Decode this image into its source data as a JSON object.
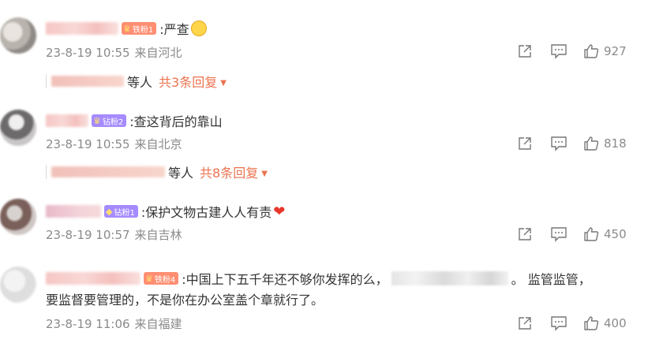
{
  "comments": [
    {
      "badge": "铁粉1",
      "text": ":严查",
      "time": "23-8-19 10:55",
      "source": "来自河北",
      "likes": "927",
      "sub": {
        "deng": "等人",
        "more": "共3条回复"
      }
    },
    {
      "badge": "钻粉2",
      "text": ":查这背后的靠山",
      "time": "23-8-19 10:55",
      "source": "来自北京",
      "likes": "818",
      "sub": {
        "deng": "等人",
        "more": "共8条回复"
      }
    },
    {
      "badge": "钻粉1",
      "text": ":保护文物古建人人有责",
      "time": "23-8-19 10:57",
      "source": "来自吉林",
      "likes": "450"
    },
    {
      "badge": "铁粉4",
      "text_part1": ":中国上下五千年还不够你发挥的么，",
      "text_part2": "。 监管监管，",
      "text_line2": "要监督要管理的，不是你在办公室盖个章就行了。",
      "time": "23-8-19 11:06",
      "source": "来自福建",
      "likes": "400"
    }
  ],
  "colors": {
    "accent": "#eb7350",
    "meta": "#8a8a8a",
    "text": "#333333"
  },
  "icons": [
    "forward-icon",
    "comment-icon",
    "like-icon",
    "crown-icon",
    "diamond-icon"
  ]
}
